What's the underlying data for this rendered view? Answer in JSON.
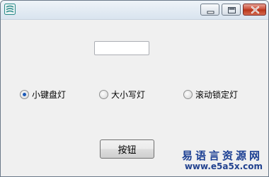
{
  "window": {
    "title": "",
    "icon": "app-icon",
    "controls": {
      "minimize_icon": "minimize-icon",
      "maximize_icon": "maximize-icon",
      "close_icon": "close-icon"
    }
  },
  "form": {
    "edit_box": {
      "value": "",
      "placeholder": ""
    },
    "radios": [
      {
        "label": "小键盘灯",
        "checked": true
      },
      {
        "label": "大小写灯",
        "checked": false
      },
      {
        "label": "滚动锁定灯",
        "checked": false
      }
    ],
    "button_label": "按钮"
  },
  "watermark": {
    "site_name": "易语言资源网",
    "url": "www.e5a5x.com"
  },
  "colors": {
    "window_bg": "#f0f0f0",
    "close_button": "#c6452f",
    "radio_selected": "#1c5ab8",
    "watermark": "#1b3f93"
  }
}
